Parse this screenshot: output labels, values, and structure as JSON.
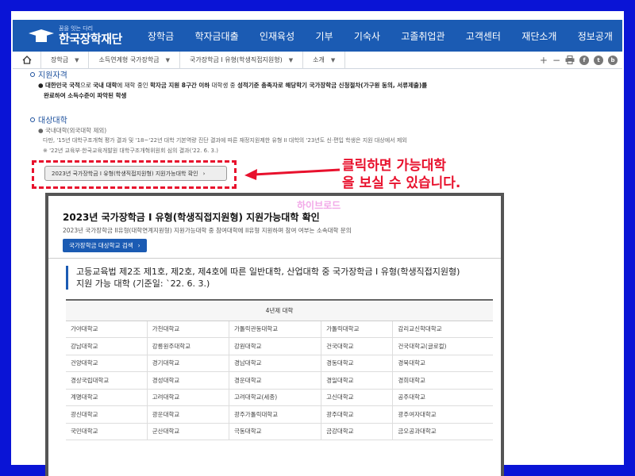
{
  "header": {
    "logo_sub": "꿈을 잇는 다리",
    "logo_main": "한국장학재단",
    "nav": [
      "장학금",
      "학자금대출",
      "인재육성",
      "기부",
      "기숙사",
      "고졸취업관",
      "고객센터",
      "재단소개",
      "정보공개"
    ]
  },
  "breadcrumb": {
    "home_icon": "home-icon",
    "items": [
      "장학금",
      "소득연계형 국가장학금",
      "국가장학금 I 유형(학생직접지원형)",
      "소개"
    ],
    "tools": [
      "+",
      "−"
    ]
  },
  "section1": {
    "title": "지원자격",
    "line1_a": "대한민국 국적",
    "line1_b": "으로 ",
    "line1_c": "국내 대학",
    "line1_d": "에 재학 중인 ",
    "line1_e": "학자금 지원 8구간 이하",
    "line1_f": " 대학생 중 ",
    "line1_g": "성적기준 충족자로 해당학기 국가장학금 신청절차(가구원 동의, 서류제출)를",
    "line2": "완료하여 소득수준이 파악된 학생"
  },
  "section2": {
    "title": "대상대학",
    "item": "국내대학(외국대학 제외)",
    "note1": "다만, '15년 대학구조개혁 평가 결과 및 '18~'22년 대학 기본역량 진단 결과에 따른 재정지원제한 유형 II 대학의 '23년도 신·편입 학생은 지원 대상에서 제외",
    "note2": "※ '22년 교육부·한국교육개발원 대학구조개혁위원회 심의 결과('22. 6. 3.)",
    "button": "2023년 국가장학금 I 유형(학생직접지원형) 지원가능대학 확인"
  },
  "annotation": {
    "line1": "클릭하면 가능대학",
    "line2": "을 보실 수 있습니다.",
    "watermark": "하이브로드"
  },
  "popup": {
    "title": "2023년 국가장학금 I 유형(학생직접지원형) 지원가능대학 확인",
    "desc": "2023년 국가장학금 II유형(대학연계지원형) 지원가능대학 중 참여대학에 II유형 지원하며 참여 여부는 소속대학 문의",
    "search_button": "국가장학금 대상학교 검색",
    "subtitle_line1": "고등교육법 제2조 제1호, 제2호, 제4호에 따른 일반대학, 산업대학 중 국가장학금 I 유형(학생직접지원형)",
    "subtitle_line2": "지원 가능 대학 (기준일: `22. 6. 3.)",
    "table_header": "4년제 대학",
    "rows": [
      [
        "가야대학교",
        "가천대학교",
        "가톨릭관동대학교",
        "가톨릭대학교",
        "감리교신학대학교"
      ],
      [
        "강남대학교",
        "강릉원주대학교",
        "강원대학교",
        "건국대학교",
        "건국대학교(글로컬)"
      ],
      [
        "건양대학교",
        "경기대학교",
        "경남대학교",
        "경동대학교",
        "경북대학교"
      ],
      [
        "경상국립대학교",
        "경성대학교",
        "경운대학교",
        "경일대학교",
        "경희대학교"
      ],
      [
        "계명대학교",
        "고려대학교",
        "고려대학교(세종)",
        "고신대학교",
        "공주대학교"
      ],
      [
        "광신대학교",
        "광운대학교",
        "광주가톨릭대학교",
        "광주대학교",
        "광주여자대학교"
      ],
      [
        "국민대학교",
        "군산대학교",
        "극동대학교",
        "금강대학교",
        "금오공과대학교"
      ]
    ]
  }
}
